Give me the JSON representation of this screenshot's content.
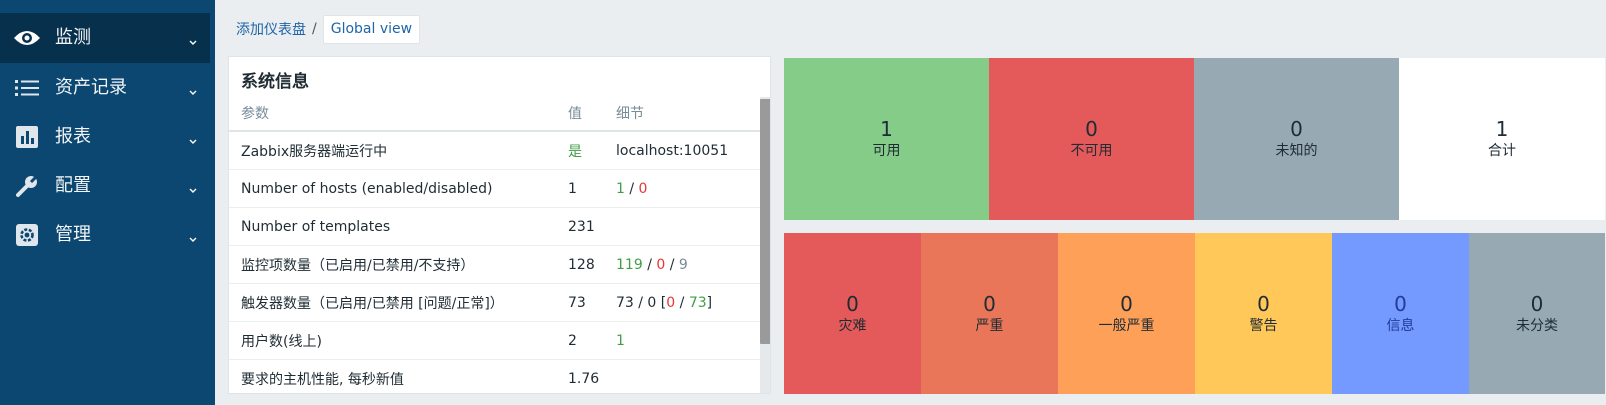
{
  "sidebar": {
    "items": [
      {
        "label": "监测",
        "icon": "eye-icon"
      },
      {
        "label": "资产记录",
        "icon": "list-icon"
      },
      {
        "label": "报表",
        "icon": "bar-chart-icon"
      },
      {
        "label": "配置",
        "icon": "wrench-icon"
      },
      {
        "label": "管理",
        "icon": "gear-icon"
      }
    ]
  },
  "breadcrumb": {
    "add_label": "添加仪表盘",
    "separator": "/",
    "current": "Global view"
  },
  "system_info": {
    "title": "系统信息",
    "headers": {
      "param": "参数",
      "value": "值",
      "detail": "细节"
    },
    "rows": [
      {
        "param": "Zabbix服务器端运行中",
        "value": "是",
        "detail": "localhost:10051"
      },
      {
        "param": "Number of hosts (enabled/disabled)",
        "value": "1",
        "detail": {
          "a": "1",
          "sep": "/",
          "b": "0"
        }
      },
      {
        "param": "Number of templates",
        "value": "231",
        "detail": ""
      },
      {
        "param": "监控项数量（已启用/已禁用/不支持）",
        "value": "128",
        "detail": {
          "a": "119",
          "sep1": "/",
          "b": "0",
          "sep2": "/",
          "c": "9"
        }
      },
      {
        "param": "触发器数量（已启用/已禁用 [问题/正常]）",
        "value": "73",
        "detail": {
          "prefix": "73 / 0 [",
          "a": "0",
          "sep": "/",
          "b": "73",
          "suffix": "]"
        }
      },
      {
        "param": "用户数(线上)",
        "value": "2",
        "detail": "1"
      },
      {
        "param": "要求的主机性能, 每秒新值",
        "value": "1.76",
        "detail": ""
      }
    ]
  },
  "host_availability": [
    {
      "count": "1",
      "label": "可用",
      "color": "#86cc89"
    },
    {
      "count": "0",
      "label": "不可用",
      "color": "#e45959"
    },
    {
      "count": "0",
      "label": "未知的",
      "color": "#97aab3"
    },
    {
      "count": "1",
      "label": "合计",
      "color": "#ffffff"
    }
  ],
  "problems_by_severity": [
    {
      "count": "0",
      "label": "灾难",
      "color": "#e45959"
    },
    {
      "count": "0",
      "label": "严重",
      "color": "#e97659"
    },
    {
      "count": "0",
      "label": "一般严重",
      "color": "#ffa059"
    },
    {
      "count": "0",
      "label": "警告",
      "color": "#ffc859"
    },
    {
      "count": "0",
      "label": "信息",
      "color": "#7499ff"
    },
    {
      "count": "0",
      "label": "未分类",
      "color": "#97aab3"
    }
  ]
}
